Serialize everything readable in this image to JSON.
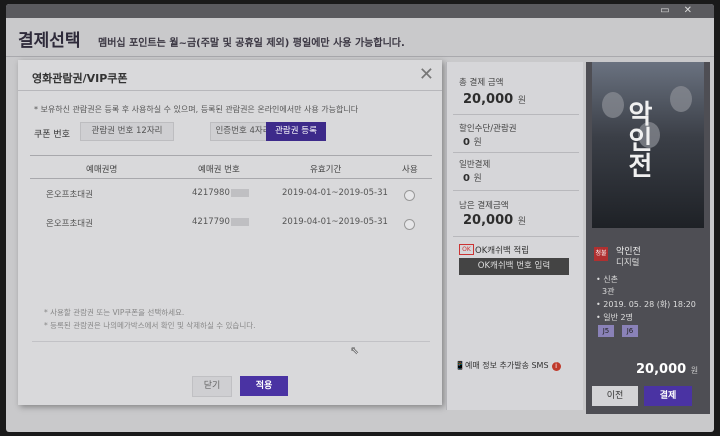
{
  "header": {
    "title": "결제선택",
    "subtitle": "멤버십 포인트는 월~금(주말 및 공휴일 제외) 평일에만 사용 가능합니다."
  },
  "modal": {
    "title": "영화관람권/VIP쿠폰",
    "close_icon": "close-icon",
    "notice": "* 보유하신 관람권은 등록 후 사용하실 수 있으며, 등록된 관람권은 온라인에서만 사용 가능합니다",
    "coupon_label": "쿠폰 번호",
    "tab1": "관람권 번호 12자리",
    "tab2": "인증번호 4자리",
    "register_label": "관람권 등록",
    "columns": [
      "예매권명",
      "예매권 번호",
      "유효기간",
      "사용"
    ],
    "rows": [
      {
        "name": "온오프초대권",
        "number": "4217980",
        "validity": "2019-04-01~2019-05-31"
      },
      {
        "name": "온오프초대권",
        "number": "4217790",
        "validity": "2019-04-01~2019-05-31"
      }
    ],
    "footnotes": [
      "* 사용할 관람권 또는 VIP쿠폰을 선택하세요.",
      "* 등록된 관람권은 나의메가박스에서 확인 및 삭제하실 수 있습니다."
    ],
    "close_label": "닫기",
    "apply_label": "적용"
  },
  "payment": {
    "total_label": "총 결제 금액",
    "total_amount": "20,000",
    "unit": "원",
    "discount_label": "할인수단/관람권",
    "discount_amount": "0",
    "general_label": "일반결제",
    "general_amount": "0",
    "remaining_label": "남은 결제금액",
    "remaining_amount": "20,000",
    "ok_logo": "OK",
    "ok_label": "OK캐쉬백 적립",
    "ok_button": "OK캐쉬백 번호 입력",
    "sms_label": "예매 정보 추가발송 SMS",
    "sms_info": "i"
  },
  "movie": {
    "poster_title": "악인전",
    "rating": "청불",
    "name": "악인전",
    "format": "디지털",
    "theater": "• 신촌",
    "screen": "3관",
    "datetime": "• 2019. 05. 28 (화) 18:20",
    "audience": "• 일반 2명",
    "seats": [
      "J5",
      "J6"
    ],
    "price": "20,000",
    "unit": "원",
    "prev_label": "이전",
    "pay_label": "결제"
  }
}
